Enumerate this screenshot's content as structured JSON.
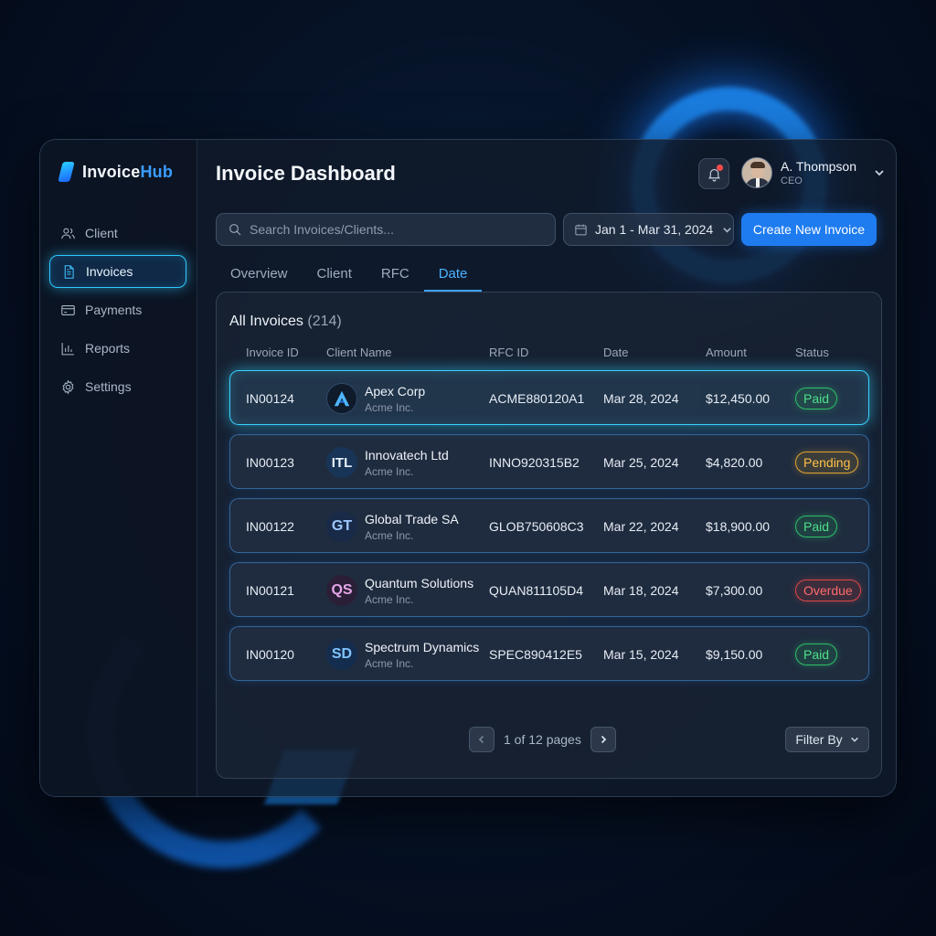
{
  "brand": {
    "name_primary": "Invoice",
    "name_accent": "Hub"
  },
  "sidebar": {
    "items": [
      {
        "label": "Client",
        "icon": "users-icon"
      },
      {
        "label": "Invoices",
        "icon": "document-icon",
        "active": true
      },
      {
        "label": "Payments",
        "icon": "credit-card-icon"
      },
      {
        "label": "Reports",
        "icon": "bar-chart-icon"
      },
      {
        "label": "Settings",
        "icon": "gear-icon"
      }
    ]
  },
  "header": {
    "title": "Invoice Dashboard",
    "notification_icon": "bell-icon",
    "has_unread": true,
    "user": {
      "name": "A. Thompson",
      "role": "CEO"
    }
  },
  "toolbar": {
    "search_placeholder": "Search Invoices/Clients...",
    "date_range": "Jan 1 - Mar 31, 2024",
    "create_label": "Create New Invoice"
  },
  "tabs": [
    {
      "label": "Overview"
    },
    {
      "label": "Client"
    },
    {
      "label": "RFC"
    },
    {
      "label": "Date",
      "active": true
    }
  ],
  "table": {
    "title": "All Invoices",
    "count": "(214)",
    "columns": [
      "Invoice ID",
      "Client Name",
      "RFC ID",
      "Date",
      "Amount",
      "Status"
    ],
    "rows": [
      {
        "id": "IN00124",
        "client": "Apex Corp",
        "client_sub": "Acme Inc.",
        "logo": "",
        "rfc": "ACME880120A1",
        "date": "Mar 28, 2024",
        "amount": "$12,450.00",
        "status": "Paid",
        "status_type": "paid",
        "selected": true
      },
      {
        "id": "IN00123",
        "client": "Innovatech Ltd",
        "client_sub": "Acme Inc.",
        "logo": "ITL",
        "rfc": "INNO920315B2",
        "date": "Mar 25, 2024",
        "amount": "$4,820.00",
        "status": "Pending",
        "status_type": "pending"
      },
      {
        "id": "IN00122",
        "client": "Global Trade SA",
        "client_sub": "Acme Inc.",
        "logo": "GT",
        "rfc": "GLOB750608C3",
        "date": "Mar 22, 2024",
        "amount": "$18,900.00",
        "status": "Paid",
        "status_type": "paid"
      },
      {
        "id": "IN00121",
        "client": "Quantum Solutions",
        "client_sub": "Acme Inc.",
        "logo": "QS",
        "rfc": "QUAN811105D4",
        "date": "Mar 18, 2024",
        "amount": "$7,300.00",
        "status": "Overdue",
        "status_type": "overdue"
      },
      {
        "id": "IN00120",
        "client": "Spectrum Dynamics",
        "client_sub": "Acme Inc.",
        "logo": "SD",
        "rfc": "SPEC890412E5",
        "date": "Mar 15, 2024",
        "amount": "$9,150.00",
        "status": "Paid",
        "status_type": "paid"
      }
    ]
  },
  "pagination": {
    "label": "1 of 12 pages"
  },
  "filter": {
    "label": "Filter By"
  },
  "colors": {
    "accent": "#1f7cf0",
    "highlight": "#36d4ff",
    "paid": "#2fbf6b",
    "pending": "#e0a331",
    "overdue": "#e04747"
  }
}
